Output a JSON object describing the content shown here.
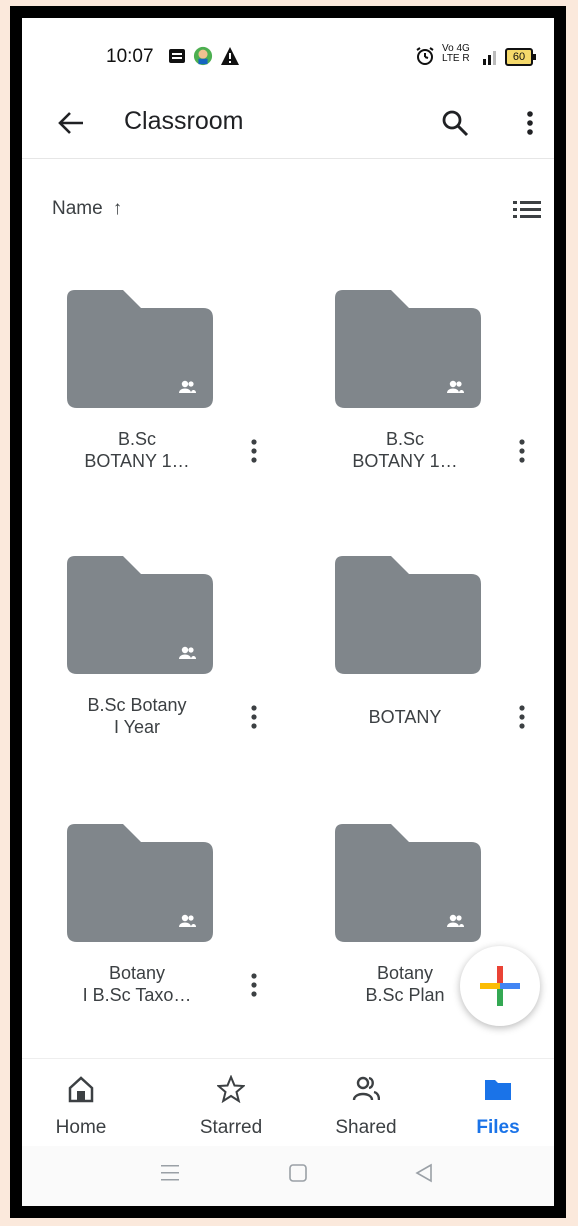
{
  "status_bar": {
    "time": "10:07",
    "battery": "60",
    "network_top": "Vo 4G",
    "network_bottom": "LTE R"
  },
  "app_bar": {
    "title": "Classroom"
  },
  "sort": {
    "label": "Name",
    "direction_glyph": "↑"
  },
  "folders": [
    {
      "line1": "B.Sc",
      "line2": "BOTANY 1…",
      "shared": true
    },
    {
      "line1": "B.Sc",
      "line2": "BOTANY 1…",
      "shared": true
    },
    {
      "line1": "B.Sc Botany",
      "line2": "I Year",
      "shared": true
    },
    {
      "line1": "BOTANY",
      "line2": "",
      "shared": false
    },
    {
      "line1": "Botany",
      "line2": "I B.Sc Taxo…",
      "shared": true
    },
    {
      "line1": "Botany",
      "line2": "B.Sc Plan",
      "shared": true
    }
  ],
  "bottom_nav": {
    "items": [
      {
        "label": "Home",
        "icon": "home-icon"
      },
      {
        "label": "Starred",
        "icon": "star-icon"
      },
      {
        "label": "Shared",
        "icon": "people-icon"
      },
      {
        "label": "Files",
        "icon": "folder-icon"
      }
    ],
    "active": "Files"
  },
  "colors": {
    "folder": "#80868b",
    "active": "#1a73e8",
    "text": "#3c4043"
  }
}
